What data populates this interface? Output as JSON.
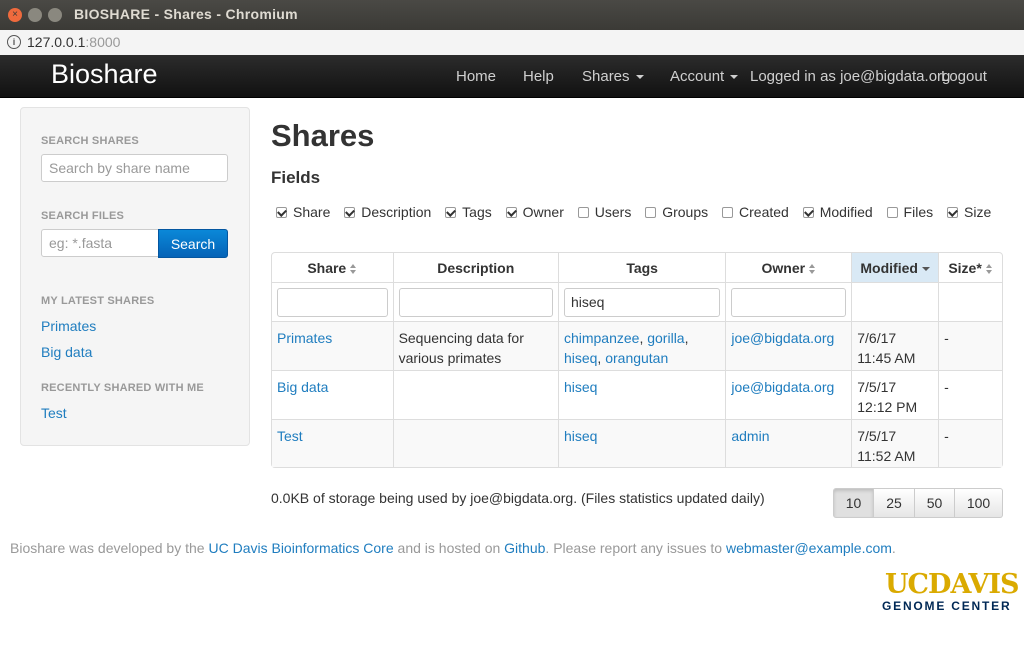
{
  "window": {
    "title": "BIOSHARE - Shares - Chromium"
  },
  "addressbar": {
    "host": "127.0.0.1",
    "port": ":8000"
  },
  "navbar": {
    "brand": "Bioshare",
    "items": [
      {
        "label": "Home"
      },
      {
        "label": "Help"
      },
      {
        "label": "Shares"
      },
      {
        "label": "Account"
      }
    ],
    "logged_in": "Logged in as joe@bigdata.org",
    "logout": "Logout"
  },
  "sidebar": {
    "search_shares_heading": "SEARCH SHARES",
    "search_shares_placeholder": "Search by share name",
    "search_files_heading": "SEARCH FILES",
    "search_files_placeholder": "eg: *.fasta",
    "search_button": "Search",
    "latest_heading": "MY LATEST SHARES",
    "latest": [
      "Primates",
      "Big data"
    ],
    "recent_heading": "RECENTLY SHARED WITH ME",
    "recent": [
      "Test"
    ]
  },
  "main": {
    "title": "Shares",
    "fields_heading": "Fields",
    "fields": [
      {
        "label": "Share",
        "checked": true
      },
      {
        "label": "Description",
        "checked": true
      },
      {
        "label": "Tags",
        "checked": true
      },
      {
        "label": "Owner",
        "checked": true
      },
      {
        "label": "Users",
        "checked": false
      },
      {
        "label": "Groups",
        "checked": false
      },
      {
        "label": "Created",
        "checked": false
      },
      {
        "label": "Modified",
        "checked": true
      },
      {
        "label": "Files",
        "checked": false
      },
      {
        "label": "Size",
        "checked": true
      }
    ],
    "table": {
      "columns": [
        "Share",
        "Description",
        "Tags",
        "Owner",
        "Modified",
        "Size*"
      ],
      "filters": {
        "share": "",
        "description": "",
        "tags": "hiseq",
        "owner": ""
      },
      "rows": [
        {
          "share": "Primates",
          "description": "Sequencing data for various primates",
          "tags": [
            "chimpanzee",
            "gorilla",
            "hiseq",
            "orangutan"
          ],
          "owner": "joe@bigdata.org",
          "modified_date": "7/6/17",
          "modified_time": "11:45 AM",
          "size": "-"
        },
        {
          "share": "Big data",
          "description": "",
          "tags": [
            "hiseq"
          ],
          "owner": "joe@bigdata.org",
          "modified_date": "7/5/17",
          "modified_time": "12:12 PM",
          "size": "-"
        },
        {
          "share": "Test",
          "description": "",
          "tags": [
            "hiseq"
          ],
          "owner": "admin",
          "modified_date": "7/5/17",
          "modified_time": "11:52 AM",
          "size": "-"
        }
      ]
    },
    "storage_text": "0.0KB of storage being used by joe@bigdata.org. (Files statistics updated daily)",
    "page_sizes": [
      "10",
      "25",
      "50",
      "100"
    ],
    "selected_page_size": "10"
  },
  "footer": {
    "t1": "Bioshare was developed by the ",
    "link1": "UC Davis Bioinformatics Core",
    "t2": " and is hosted on ",
    "link2": "Github",
    "t3": ". Please report any issues to ",
    "link3": "webmaster@example.com",
    "t4": "."
  },
  "logo": {
    "line1": "UCDAVIS",
    "line2": "GENOME CENTER"
  }
}
